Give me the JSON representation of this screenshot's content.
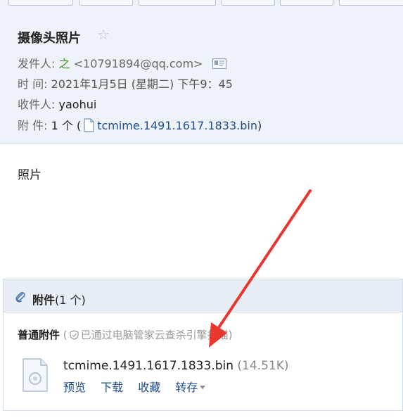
{
  "subject": "摄像头照片",
  "header": {
    "from_label": "发件人:",
    "sender_name": "之",
    "sender_email": "<10791894@qq.com>",
    "time_label": "时 间:",
    "time_value": "2021年1月5日 (星期二) 下午9：45",
    "to_label": "收件人:",
    "to_value": "yaohui",
    "attach_label": "附 件:",
    "attach_count": "1 个",
    "attach_open_paren": "(",
    "attach_filename": "tcmime.1491.1617.1833.bin",
    "attach_close_paren": ")"
  },
  "body_text": "照片",
  "attachments": {
    "title": "附件",
    "count": "(1 个)",
    "normal_label": "普通附件",
    "scan_note_open": "(",
    "scan_note": "已通过电脑管家云查杀引擎扫描",
    "scan_note_close": ")",
    "file_name": "tcmime.1491.1617.1833.bin",
    "file_size": "(14.51K)",
    "actions": {
      "preview": "预览",
      "download": "下载",
      "favorite": "收藏",
      "save_to": "转存"
    }
  },
  "colors": {
    "header_bg": "#eef3f9",
    "link": "#1f4e8c",
    "sender_green": "#3a8e1c",
    "arrow_red": "#e8372f"
  }
}
